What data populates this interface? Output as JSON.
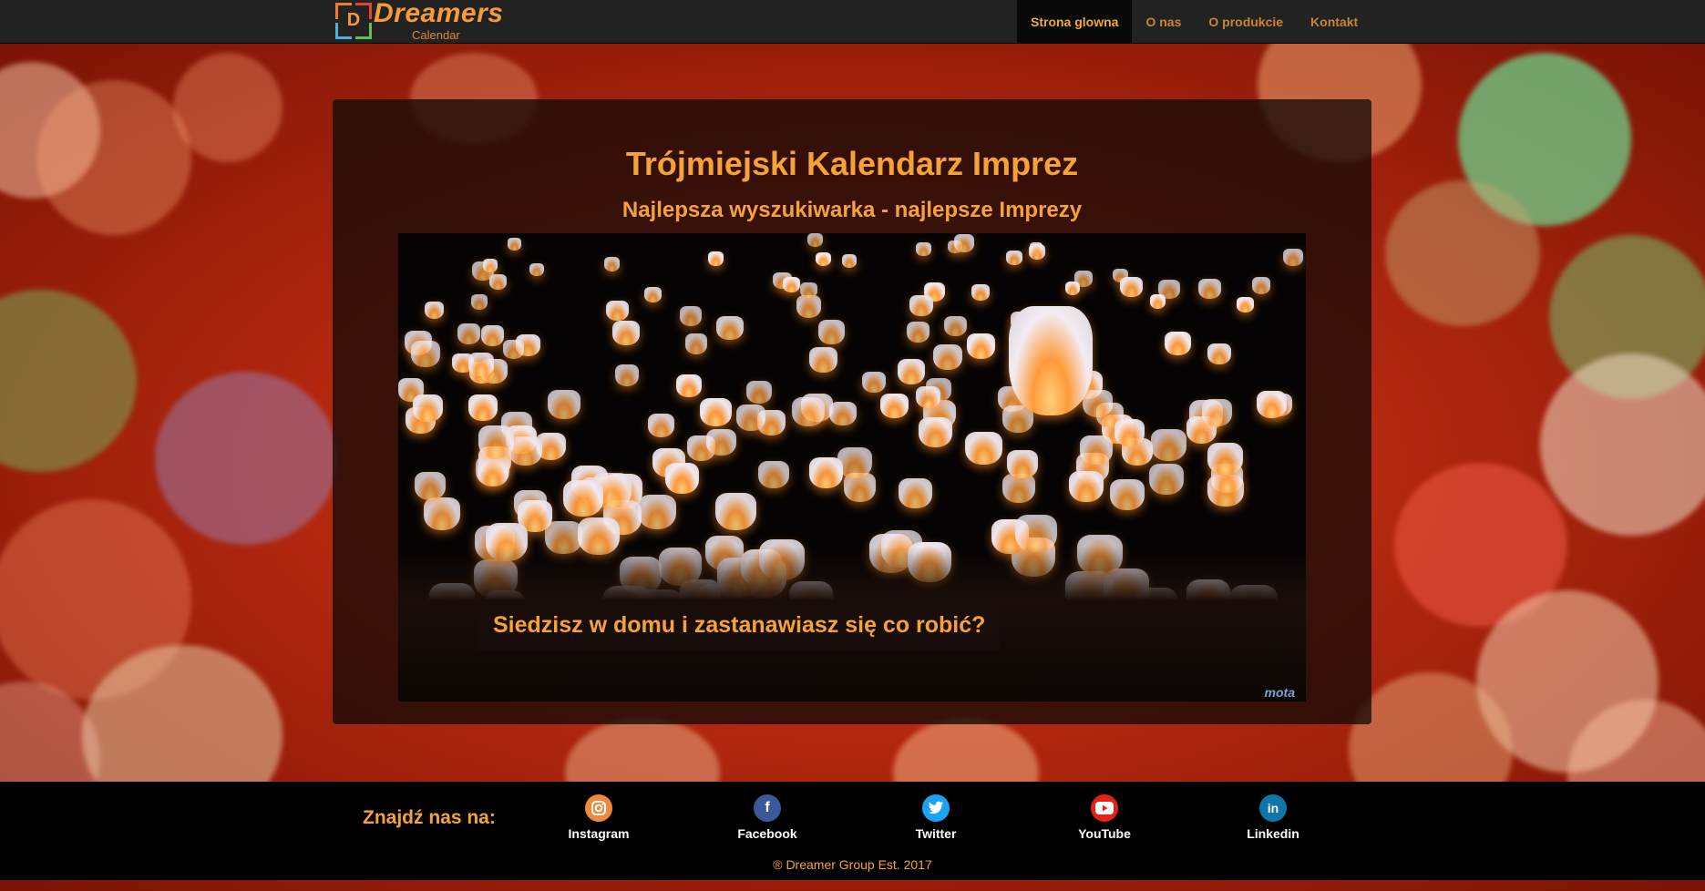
{
  "brand": {
    "name": "Dreamers",
    "sub": "Calendar",
    "letter": "D"
  },
  "nav": {
    "items": [
      {
        "label": "Strona glowna",
        "active": true
      },
      {
        "label": "O nas",
        "active": false
      },
      {
        "label": "O produkcie",
        "active": false
      },
      {
        "label": "Kontakt",
        "active": false
      }
    ]
  },
  "main": {
    "title": "Trójmiejski Kalendarz Imprez",
    "subtitle": "Najlepsza wyszukiwarka - najlepsze Imprezy",
    "caption": "Siedzisz w domu i zastanawiasz się co robić?",
    "watermark": "mota"
  },
  "footer": {
    "find_label": "Znajdź nas na:",
    "social": [
      {
        "label": "Instagram",
        "icon": "instagram-icon",
        "color": "#f08a3a"
      },
      {
        "label": "Facebook",
        "icon": "facebook-icon",
        "color": "#3b5998"
      },
      {
        "label": "Twitter",
        "icon": "twitter-icon",
        "color": "#1da1f2"
      },
      {
        "label": "YouTube",
        "icon": "youtube-icon",
        "color": "#e62117"
      },
      {
        "label": "Linkedin",
        "icon": "linkedin-icon",
        "color": "#0e76a8"
      }
    ],
    "copyright": "® Dreamer Group Est. 2017"
  },
  "colors": {
    "accent": "#f5a238",
    "navbar": "#222222",
    "nav_active": "#080808"
  }
}
